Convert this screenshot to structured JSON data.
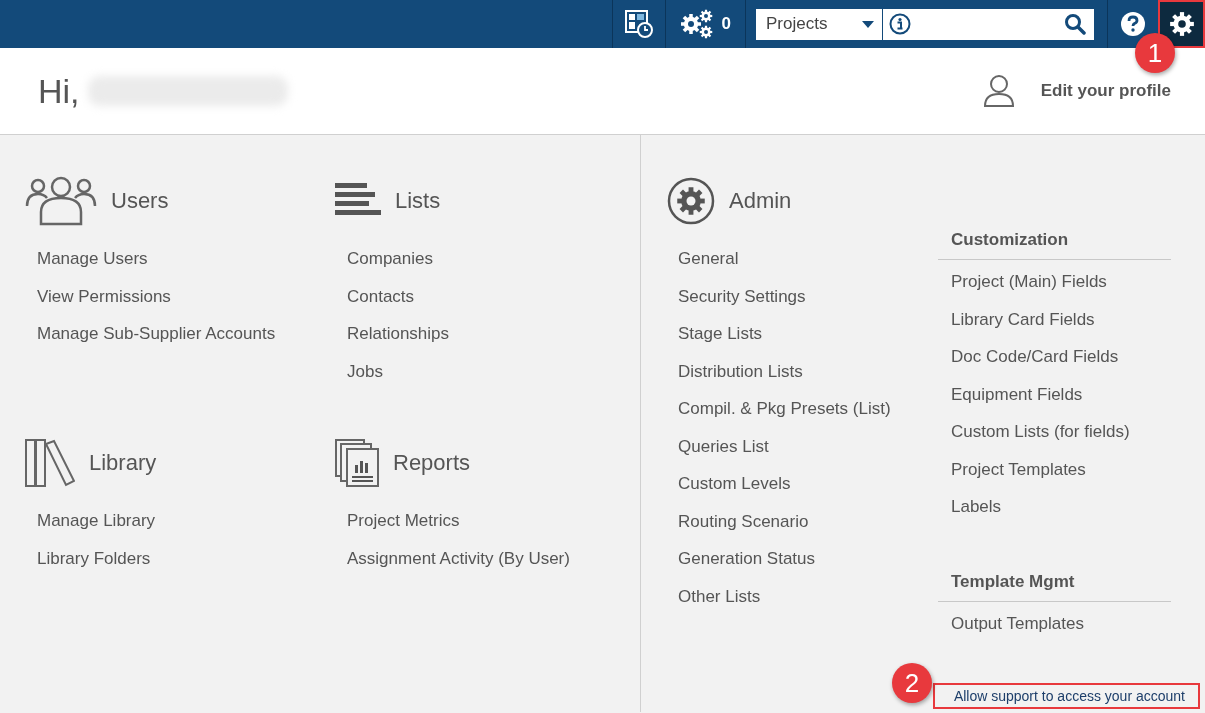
{
  "top_bar": {
    "notification_count": "0",
    "search_scope": "Projects",
    "settings_selected": true
  },
  "header": {
    "greeting": "Hi,",
    "edit_profile": "Edit your profile"
  },
  "sections": [
    {
      "title": "Users",
      "items": [
        "Manage Users",
        "View Permissions",
        "Manage Sub-Supplier Accounts"
      ]
    },
    {
      "title": "Lists",
      "items": [
        "Companies",
        "Contacts",
        "Relationships",
        "Jobs"
      ]
    },
    {
      "title": "Library",
      "items": [
        "Manage Library",
        "Library Folders"
      ]
    },
    {
      "title": "Reports",
      "items": [
        "Project Metrics",
        "Assignment Activity (By User)"
      ]
    }
  ],
  "admin": {
    "title": "Admin",
    "items": [
      "General",
      "Security Settings",
      "Stage Lists",
      "Distribution Lists",
      "Compil. & Pkg Presets (List)",
      "Queries List",
      "Custom Levels",
      "Routing Scenario",
      "Generation Status",
      "Other Lists"
    ],
    "groups": [
      {
        "heading": "Customization",
        "items": [
          "Project (Main) Fields",
          "Library Card Fields",
          "Doc Code/Card Fields",
          "Equipment Fields",
          "Custom Lists (for fields)",
          "Project Templates",
          "Labels"
        ]
      },
      {
        "heading": "Template Mgmt",
        "items": [
          "Output Templates"
        ]
      }
    ]
  },
  "support_link": "Allow support to access your account",
  "callouts": [
    "1",
    "2"
  ]
}
